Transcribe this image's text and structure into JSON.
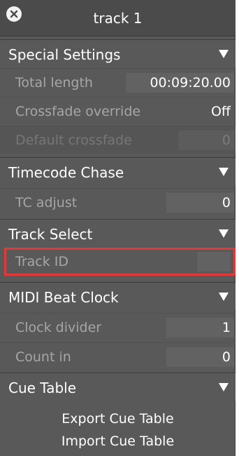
{
  "window": {
    "title": "track 1",
    "close_icon": "close-icon",
    "colors": {
      "panel_bg": "#595959",
      "highlight": "#e03a3a"
    }
  },
  "sections": {
    "special_settings": {
      "title": "Special Settings",
      "rows": {
        "total_length": {
          "label": "Total length",
          "value": "00:09:20.00"
        },
        "crossfade_override": {
          "label": "Crossfade override",
          "value": "Off"
        },
        "default_crossfade": {
          "label": "Default crossfade",
          "value": "0"
        }
      }
    },
    "timecode_chase": {
      "title": "Timecode Chase",
      "rows": {
        "tc_adjust": {
          "label": "TC adjust",
          "value": "0"
        }
      }
    },
    "track_select": {
      "title": "Track Select",
      "rows": {
        "track_id": {
          "label": "Track ID",
          "value": ""
        }
      }
    },
    "midi_beat_clock": {
      "title": "MIDI Beat Clock",
      "rows": {
        "clock_divider": {
          "label": "Clock divider",
          "value": "1"
        },
        "count_in": {
          "label": "Count in",
          "value": "0"
        }
      }
    },
    "cue_table": {
      "title": "Cue Table",
      "export_label": "Export Cue Table",
      "import_label": "Import Cue Table"
    }
  }
}
